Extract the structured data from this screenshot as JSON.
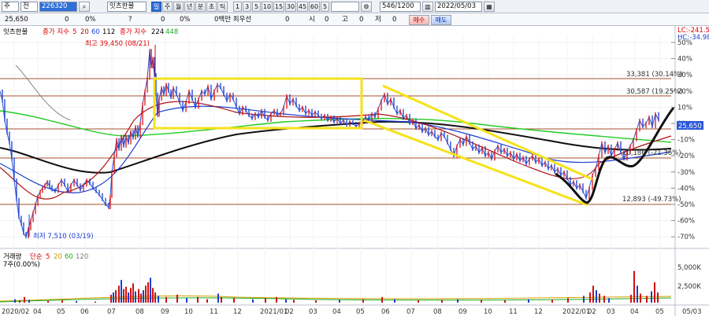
{
  "toolbar": {
    "market": "주",
    "mode": "전",
    "code": "226320",
    "stock_name": "잇츠한불",
    "periods": [
      "일",
      "주",
      "월",
      "년",
      "분",
      "초",
      "틱"
    ],
    "intervals": [
      "1",
      "3",
      "5",
      "10",
      "15",
      "30",
      "45",
      "60",
      "5"
    ],
    "count": "546/1200",
    "date": "2022/05/03",
    "buy_label": "매수",
    "sell_label": "매도"
  },
  "info_row": {
    "price": "25,650",
    "change": "0",
    "change_pct": "0%",
    "open_label": "0",
    "open_pct": "0%",
    "volume_label": "0백만 최우선",
    "ask": "0",
    "si_label": "시",
    "si_val": "0",
    "go_label": "고",
    "go_val": "0",
    "jeo_label": "저",
    "jeo_val": "0",
    "question": "?"
  },
  "price_legend": {
    "name": "잇츠한불",
    "ma_label": "종가 지수",
    "ma_periods": [
      "5",
      "20",
      "60",
      "112"
    ],
    "ma2_label": "종가 지수",
    "ma2_periods": [
      "224",
      "448"
    ]
  },
  "indicators": {
    "lc": "LC:-241.54",
    "hc": "HC:-34.98"
  },
  "annotations": {
    "high": "최고 39,450 (08/21)",
    "low": "최저 7,510 (03/19)",
    "level_33381": "33,381 (30.14%)",
    "level_30587": "30,587 (19.25%)",
    "level_12893": "12,893 (-49.73%)",
    "level_20186": "20,186 (-21.36%)",
    "current_price": "25,650"
  },
  "volume_legend": {
    "name": "거래량",
    "ma_label": "단순",
    "periods": [
      "5",
      "20",
      "60",
      "120"
    ],
    "weekly": "7주(0.00%)"
  },
  "chart_data": {
    "type": "line",
    "y_axis_pct_ticks": [
      "50%",
      "40%",
      "30%",
      "20%",
      "10%",
      "0%",
      "-10%",
      "-20%",
      "-30%",
      "-40%",
      "-50%",
      "-60%",
      "-70%"
    ],
    "volume_ticks": [
      "5,000K",
      "2,500K"
    ],
    "x_ticks": [
      "2020/02",
      "04",
      "05",
      "06",
      "07",
      "08",
      "09",
      "10",
      "11",
      "12",
      "2021/01",
      "02",
      "03",
      "04",
      "05",
      "06",
      "07",
      "08",
      "09",
      "10",
      "11",
      "12",
      "2022/01",
      "02",
      "03",
      "04",
      "05",
      "05/03"
    ],
    "price_points": [
      [
        0,
        20
      ],
      [
        3,
        14
      ],
      [
        6,
        2
      ],
      [
        9,
        -6
      ],
      [
        12,
        -12
      ],
      [
        15,
        -22
      ],
      [
        18,
        -35
      ],
      [
        21,
        -47
      ],
      [
        24,
        -58
      ],
      [
        27,
        -62
      ],
      [
        30,
        -68
      ],
      [
        33,
        -70
      ],
      [
        36,
        -65
      ],
      [
        39,
        -60
      ],
      [
        42,
        -55
      ],
      [
        45,
        -50
      ],
      [
        48,
        -45
      ],
      [
        51,
        -42
      ],
      [
        54,
        -40
      ],
      [
        57,
        -38
      ],
      [
        60,
        -36
      ],
      [
        63,
        -39
      ],
      [
        66,
        -41
      ],
      [
        70,
        -42
      ],
      [
        74,
        -38
      ],
      [
        78,
        -35
      ],
      [
        82,
        -38
      ],
      [
        86,
        -42
      ],
      [
        90,
        -38
      ],
      [
        94,
        -35
      ],
      [
        98,
        -38
      ],
      [
        102,
        -41
      ],
      [
        106,
        -38
      ],
      [
        110,
        -35
      ],
      [
        114,
        -37
      ],
      [
        118,
        -40
      ],
      [
        122,
        -42
      ],
      [
        126,
        -44
      ],
      [
        130,
        -47
      ],
      [
        134,
        -50
      ],
      [
        138,
        -52
      ],
      [
        140,
        -45
      ],
      [
        142,
        -30
      ],
      [
        145,
        -20
      ],
      [
        148,
        -10
      ],
      [
        151,
        -16
      ],
      [
        154,
        -8
      ],
      [
        157,
        -14
      ],
      [
        160,
        -8
      ],
      [
        163,
        -12
      ],
      [
        166,
        -5
      ],
      [
        169,
        -9
      ],
      [
        172,
        -2
      ],
      [
        175,
        -8
      ],
      [
        178,
        0
      ],
      [
        181,
        12
      ],
      [
        184,
        20
      ],
      [
        187,
        28
      ],
      [
        190,
        45
      ],
      [
        192,
        35
      ],
      [
        194,
        40
      ],
      [
        196,
        30
      ],
      [
        198,
        18
      ],
      [
        200,
        5
      ],
      [
        202,
        15
      ],
      [
        205,
        22
      ],
      [
        208,
        18
      ],
      [
        211,
        24
      ],
      [
        214,
        20
      ],
      [
        217,
        16
      ],
      [
        220,
        22
      ],
      [
        224,
        18
      ],
      [
        228,
        13
      ],
      [
        232,
        8
      ],
      [
        236,
        13
      ],
      [
        240,
        20
      ],
      [
        244,
        15
      ],
      [
        248,
        10
      ],
      [
        252,
        15
      ],
      [
        256,
        20
      ],
      [
        260,
        18
      ],
      [
        264,
        23
      ],
      [
        268,
        15
      ],
      [
        272,
        20
      ],
      [
        276,
        24
      ],
      [
        280,
        22
      ],
      [
        284,
        18
      ],
      [
        288,
        14
      ],
      [
        292,
        18
      ],
      [
        296,
        15
      ],
      [
        300,
        10
      ],
      [
        304,
        6
      ],
      [
        308,
        10
      ],
      [
        312,
        8
      ],
      [
        316,
        5
      ],
      [
        320,
        3
      ],
      [
        324,
        6
      ],
      [
        328,
        4
      ],
      [
        332,
        8
      ],
      [
        336,
        4
      ],
      [
        340,
        2
      ],
      [
        344,
        6
      ],
      [
        348,
        8
      ],
      [
        352,
        5
      ],
      [
        356,
        6
      ],
      [
        360,
        10
      ],
      [
        364,
        17
      ],
      [
        368,
        12
      ],
      [
        372,
        15
      ],
      [
        376,
        11
      ],
      [
        380,
        8
      ],
      [
        384,
        10
      ],
      [
        388,
        6
      ],
      [
        392,
        8
      ],
      [
        396,
        5
      ],
      [
        400,
        7
      ],
      [
        404,
        5
      ],
      [
        408,
        3
      ],
      [
        412,
        5
      ],
      [
        416,
        2
      ],
      [
        420,
        4
      ],
      [
        424,
        1
      ],
      [
        428,
        3
      ],
      [
        432,
        0
      ],
      [
        436,
        2
      ],
      [
        440,
        -1
      ],
      [
        444,
        1
      ],
      [
        448,
        0
      ],
      [
        452,
        -2
      ],
      [
        456,
        0
      ],
      [
        460,
        1
      ],
      [
        464,
        4
      ],
      [
        468,
        2
      ],
      [
        472,
        6
      ],
      [
        476,
        4
      ],
      [
        480,
        9
      ],
      [
        484,
        14
      ],
      [
        488,
        18
      ],
      [
        492,
        12
      ],
      [
        496,
        15
      ],
      [
        500,
        10
      ],
      [
        504,
        6
      ],
      [
        508,
        8
      ],
      [
        512,
        3
      ],
      [
        516,
        5
      ],
      [
        520,
        0
      ],
      [
        524,
        2
      ],
      [
        528,
        -3
      ],
      [
        532,
        -1
      ],
      [
        536,
        -5
      ],
      [
        540,
        -3
      ],
      [
        544,
        -7
      ],
      [
        548,
        -5
      ],
      [
        552,
        -8
      ],
      [
        556,
        -10
      ],
      [
        560,
        -6
      ],
      [
        564,
        -8
      ],
      [
        568,
        -12
      ],
      [
        572,
        -16
      ],
      [
        576,
        -20
      ],
      [
        580,
        -14
      ],
      [
        584,
        -10
      ],
      [
        588,
        -13
      ],
      [
        592,
        -8
      ],
      [
        596,
        -12
      ],
      [
        600,
        -16
      ],
      [
        604,
        -14
      ],
      [
        608,
        -18
      ],
      [
        612,
        -15
      ],
      [
        616,
        -20
      ],
      [
        620,
        -18
      ],
      [
        624,
        -22
      ],
      [
        628,
        -17
      ],
      [
        632,
        -14
      ],
      [
        636,
        -18
      ],
      [
        640,
        -16
      ],
      [
        644,
        -20
      ],
      [
        648,
        -18
      ],
      [
        652,
        -22
      ],
      [
        656,
        -19
      ],
      [
        660,
        -23
      ],
      [
        664,
        -21
      ],
      [
        668,
        -25
      ],
      [
        672,
        -22
      ],
      [
        676,
        -20
      ],
      [
        680,
        -24
      ],
      [
        684,
        -22
      ],
      [
        688,
        -26
      ],
      [
        692,
        -24
      ],
      [
        696,
        -28
      ],
      [
        700,
        -26
      ],
      [
        704,
        -30
      ],
      [
        708,
        -28
      ],
      [
        712,
        -32
      ],
      [
        716,
        -30
      ],
      [
        720,
        -34
      ],
      [
        724,
        -38
      ],
      [
        728,
        -36
      ],
      [
        732,
        -40
      ],
      [
        736,
        -38
      ],
      [
        740,
        -42
      ],
      [
        744,
        -46
      ],
      [
        748,
        -40
      ],
      [
        752,
        -32
      ],
      [
        756,
        -28
      ],
      [
        760,
        -20
      ],
      [
        764,
        -12
      ],
      [
        768,
        -18
      ],
      [
        772,
        -14
      ],
      [
        776,
        -20
      ],
      [
        780,
        -16
      ],
      [
        784,
        -12
      ],
      [
        788,
        -18
      ],
      [
        792,
        -22
      ],
      [
        796,
        -18
      ],
      [
        800,
        -14
      ],
      [
        804,
        -10
      ],
      [
        808,
        -4
      ],
      [
        812,
        2
      ],
      [
        816,
        -2
      ],
      [
        820,
        0
      ],
      [
        824,
        4
      ],
      [
        828,
        -2
      ],
      [
        832,
        6
      ],
      [
        836,
        2
      ]
    ],
    "volume_bars": [
      [
        18,
        6
      ],
      [
        24,
        4
      ],
      [
        30,
        10
      ],
      [
        36,
        5
      ],
      [
        60,
        3
      ],
      [
        78,
        4
      ],
      [
        96,
        3
      ],
      [
        120,
        2
      ],
      [
        140,
        14
      ],
      [
        143,
        18
      ],
      [
        146,
        22
      ],
      [
        150,
        30
      ],
      [
        153,
        40
      ],
      [
        156,
        24
      ],
      [
        159,
        28
      ],
      [
        162,
        18
      ],
      [
        165,
        26
      ],
      [
        168,
        34
      ],
      [
        171,
        20
      ],
      [
        175,
        24
      ],
      [
        178,
        16
      ],
      [
        181,
        22
      ],
      [
        184,
        30
      ],
      [
        187,
        36
      ],
      [
        190,
        44
      ],
      [
        193,
        26
      ],
      [
        196,
        18
      ],
      [
        200,
        12
      ],
      [
        210,
        10
      ],
      [
        224,
        14
      ],
      [
        236,
        8
      ],
      [
        250,
        10
      ],
      [
        262,
        6
      ],
      [
        276,
        16
      ],
      [
        280,
        10
      ],
      [
        296,
        8
      ],
      [
        320,
        6
      ],
      [
        336,
        8
      ],
      [
        350,
        10
      ],
      [
        362,
        6
      ],
      [
        372,
        5
      ],
      [
        400,
        4
      ],
      [
        430,
        5
      ],
      [
        460,
        6
      ],
      [
        484,
        10
      ],
      [
        500,
        6
      ],
      [
        530,
        4
      ],
      [
        560,
        5
      ],
      [
        580,
        6
      ],
      [
        610,
        5
      ],
      [
        640,
        4
      ],
      [
        670,
        6
      ],
      [
        700,
        5
      ],
      [
        720,
        8
      ],
      [
        740,
        12
      ],
      [
        748,
        18
      ],
      [
        752,
        30
      ],
      [
        756,
        22
      ],
      [
        760,
        16
      ],
      [
        766,
        12
      ],
      [
        772,
        8
      ],
      [
        800,
        14
      ],
      [
        804,
        56
      ],
      [
        808,
        30
      ],
      [
        812,
        16
      ],
      [
        820,
        12
      ],
      [
        826,
        20
      ],
      [
        830,
        36
      ],
      [
        834,
        18
      ]
    ]
  }
}
